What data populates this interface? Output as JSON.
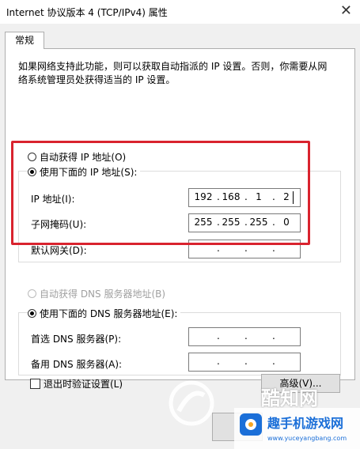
{
  "window": {
    "title": "Internet 协议版本 4 (TCP/IPv4) 属性",
    "close_glyph": "✕"
  },
  "tab": {
    "label": "常规"
  },
  "description": "如果网络支持此功能，则可以获取自动指派的 IP 设置。否则，你需要从网络系统管理员处获得适当的 IP 设置。",
  "ip": {
    "auto_label": "自动获得 IP 地址(O)",
    "manual_label": "使用下面的 IP 地址(S):",
    "address_label": "IP 地址(I):",
    "mask_label": "子网掩码(U):",
    "gateway_label": "默认网关(D):",
    "address": [
      "192",
      "168",
      "1",
      "2"
    ],
    "mask": [
      "255",
      "255",
      "255",
      "0"
    ],
    "gateway": [
      "",
      "",
      "",
      ""
    ]
  },
  "dns": {
    "auto_label": "自动获得 DNS 服务器地址(B)",
    "manual_label": "使用下面的 DNS 服务器地址(E):",
    "preferred_label": "首选 DNS 服务器(P):",
    "alternate_label": "备用 DNS 服务器(A):",
    "preferred": [
      "",
      "",
      "",
      ""
    ],
    "alternate": [
      "",
      "",
      "",
      ""
    ]
  },
  "validate_label": "退出时验证设置(L)",
  "advanced_label": "高级(V)...",
  "watermark": {
    "brand": "酷知网",
    "site_title": "趣手机游戏网",
    "site_url": "www.yuceyangbang.com"
  },
  "colors": {
    "highlight": "#d9232e",
    "watermark_blue": "#1b6fd8"
  }
}
